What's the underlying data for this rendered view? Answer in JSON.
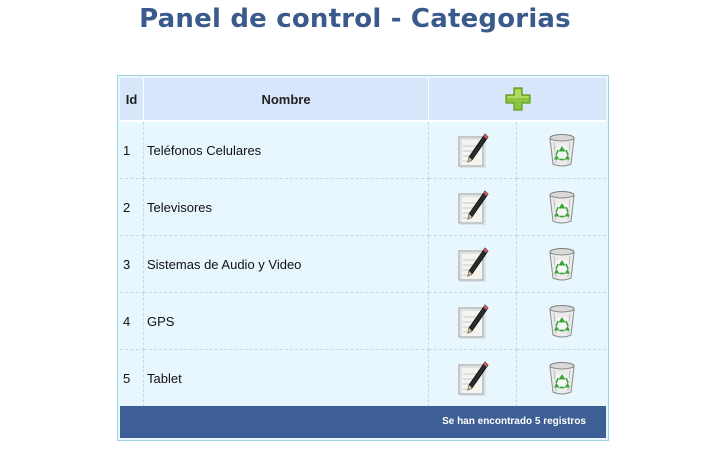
{
  "page": {
    "title": "Panel de control - Categorias"
  },
  "table": {
    "headers": {
      "id": "Id",
      "name": "Nombre"
    },
    "add_icon": "plus-icon",
    "rows": [
      {
        "id": "1",
        "name": "Teléfonos Celulares"
      },
      {
        "id": "2",
        "name": "Televisores"
      },
      {
        "id": "3",
        "name": "Sistemas de Audio y Video"
      },
      {
        "id": "4",
        "name": "GPS"
      },
      {
        "id": "5",
        "name": "Tablet"
      }
    ],
    "edit_icon": "edit-pencil-icon",
    "delete_icon": "recycle-bin-icon",
    "footer_text": "Se han encontrado 5 registros"
  },
  "colors": {
    "title": "#3b5a8c",
    "header_bg": "#d7e6fb",
    "row_bg": "#e8f6fd",
    "footer_bg": "#3e5f95",
    "plus": "#8cc63f"
  }
}
